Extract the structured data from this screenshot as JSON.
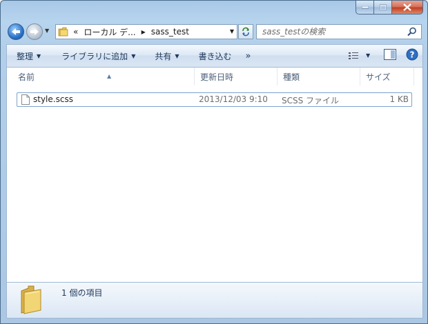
{
  "window": {
    "caption_buttons": [
      "minimize",
      "maximize",
      "close"
    ]
  },
  "nav": {
    "breadcrumb_prefix": "«",
    "breadcrumb_1": "ローカル デ...",
    "breadcrumb_2": "sass_test",
    "search_placeholder": "sass_testの検索"
  },
  "toolbar": {
    "organize": "整理",
    "include_library": "ライブラリに追加",
    "share": "共有",
    "burn": "書き込む",
    "more": "»"
  },
  "columns": {
    "name": "名前",
    "date": "更新日時",
    "type": "種類",
    "size": "サイズ"
  },
  "files": [
    {
      "name": "style.scss",
      "date": "2013/12/03 9:10",
      "type": "SCSS ファイル",
      "size": "1 KB"
    }
  ],
  "details": {
    "count_text": "1 個の項目"
  },
  "colors": {
    "accent": "#2c74c9",
    "selection_border": "#7da2ce",
    "header_text": "#4c607a"
  }
}
